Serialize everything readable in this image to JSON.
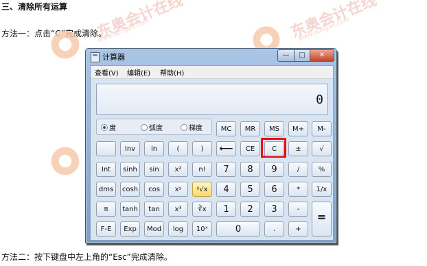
{
  "doc": {
    "heading": "三、清除所有运算",
    "method1": "方法一：点击“C”完成清除。",
    "method2": "方法二：按下键盘中左上角的“Esc”完成清除。"
  },
  "window": {
    "title": "计算器",
    "controls": {
      "minimize": "—",
      "maximize": "□",
      "close": "✕"
    },
    "icon": "calculator-icon"
  },
  "menu": {
    "view": "查看(V)",
    "edit": "编辑(E)",
    "help": "帮助(H)"
  },
  "display": {
    "value": "0"
  },
  "angle_modes": {
    "degrees": "度",
    "radians": "弧度",
    "grads": "梯度",
    "selected": "度"
  },
  "keys": {
    "memory": [
      "MC",
      "MR",
      "MS",
      "M+",
      "M-"
    ],
    "row1": [
      "",
      "Inv",
      "ln",
      "(",
      ")",
      "⟵",
      "CE",
      "C",
      "±",
      "√"
    ],
    "row2": [
      "Int",
      "sinh",
      "sin",
      "x²",
      "n!",
      "7",
      "8",
      "9",
      "/",
      "%"
    ],
    "row3": [
      "dms",
      "cosh",
      "cos",
      "xʸ",
      "ʸ√x",
      "4",
      "5",
      "6",
      "*",
      "1/x"
    ],
    "row4": [
      "π",
      "tanh",
      "tan",
      "x³",
      "∛x",
      "1",
      "2",
      "3",
      "-",
      "="
    ],
    "row5": [
      "F-E",
      "Exp",
      "Mod",
      "log",
      "10ˣ",
      "0",
      ".",
      "+"
    ]
  },
  "annotation": {
    "highlighted_key": "C",
    "color": "#ee0c0c"
  },
  "watermark": {
    "site": "www.dongao.com"
  }
}
